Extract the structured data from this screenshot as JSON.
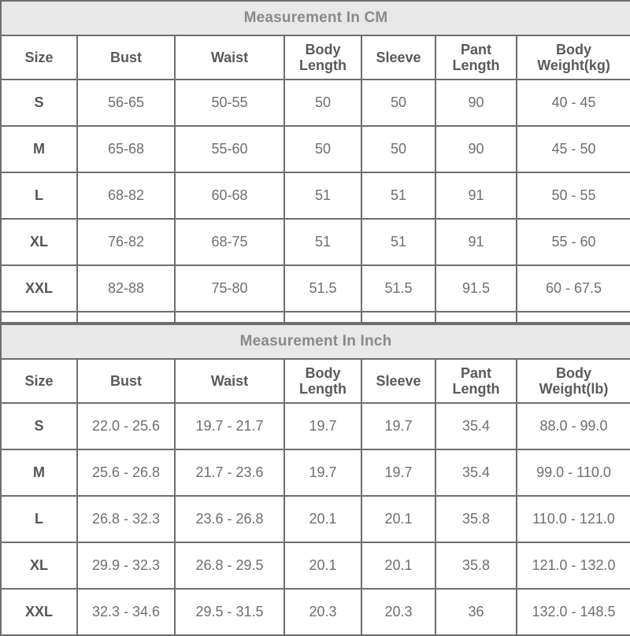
{
  "tables": [
    {
      "title": "Measurement In CM",
      "columns": [
        "Size",
        "Bust",
        "Waist",
        "Body Length",
        "Sleeve",
        "Pant Length",
        "Body Weight(kg)"
      ],
      "column_labels_lines": [
        [
          "Size"
        ],
        [
          "Bust"
        ],
        [
          "Waist"
        ],
        [
          "Body",
          "Length"
        ],
        [
          "Sleeve"
        ],
        [
          "Pant",
          "Length"
        ],
        [
          "Body",
          "Weight(kg)"
        ]
      ],
      "rows": [
        {
          "size": "S",
          "bust": "56-65",
          "waist": "50-55",
          "body_length": "50",
          "sleeve": "50",
          "pant_length": "90",
          "body_weight": "40 - 45"
        },
        {
          "size": "M",
          "bust": "65-68",
          "waist": "55-60",
          "body_length": "50",
          "sleeve": "50",
          "pant_length": "90",
          "body_weight": "45 - 50"
        },
        {
          "size": "L",
          "bust": "68-82",
          "waist": "60-68",
          "body_length": "51",
          "sleeve": "51",
          "pant_length": "91",
          "body_weight": "50 - 55"
        },
        {
          "size": "XL",
          "bust": "76-82",
          "waist": "68-75",
          "body_length": "51",
          "sleeve": "51",
          "pant_length": "91",
          "body_weight": "55 - 60"
        },
        {
          "size": "XXL",
          "bust": "82-88",
          "waist": "75-80",
          "body_length": "51.5",
          "sleeve": "51.5",
          "pant_length": "91.5",
          "body_weight": "60 - 67.5"
        }
      ]
    },
    {
      "title": "Measurement In Inch",
      "columns": [
        "Size",
        "Bust",
        "Waist",
        "Body Length",
        "Sleeve",
        "Pant Length",
        "Body Weight(lb)"
      ],
      "column_labels_lines": [
        [
          "Size"
        ],
        [
          "Bust"
        ],
        [
          "Waist"
        ],
        [
          "Body",
          "Length"
        ],
        [
          "Sleeve"
        ],
        [
          "Pant",
          "Length"
        ],
        [
          "Body",
          "Weight(lb)"
        ]
      ],
      "rows": [
        {
          "size": "S",
          "bust": "22.0 - 25.6",
          "waist": "19.7 - 21.7",
          "body_length": "19.7",
          "sleeve": "19.7",
          "pant_length": "35.4",
          "body_weight": "88.0 - 99.0"
        },
        {
          "size": "M",
          "bust": "25.6 - 26.8",
          "waist": "21.7 - 23.6",
          "body_length": "19.7",
          "sleeve": "19.7",
          "pant_length": "35.4",
          "body_weight": "99.0 - 110.0"
        },
        {
          "size": "L",
          "bust": "26.8 - 32.3",
          "waist": "23.6 - 26.8",
          "body_length": "20.1",
          "sleeve": "20.1",
          "pant_length": "35.8",
          "body_weight": "110.0 - 121.0"
        },
        {
          "size": "XL",
          "bust": "29.9 - 32.3",
          "waist": "26.8 - 29.5",
          "body_length": "20.1",
          "sleeve": "20.1",
          "pant_length": "35.8",
          "body_weight": "121.0 - 132.0"
        },
        {
          "size": "XXL",
          "bust": "32.3 - 34.6",
          "waist": "29.5 - 31.5",
          "body_length": "20.3",
          "sleeve": "20.3",
          "pant_length": "36",
          "body_weight": "132.0 - 148.5"
        }
      ]
    }
  ],
  "colors": {
    "border": "#6e6e6e",
    "title_background": "#e8e8e8",
    "title_text": "#8a8a8a",
    "header_text": "#5a5a5a",
    "size_text": "#555555",
    "data_text": "#6f6f6f",
    "page_background": "#ffffff"
  }
}
